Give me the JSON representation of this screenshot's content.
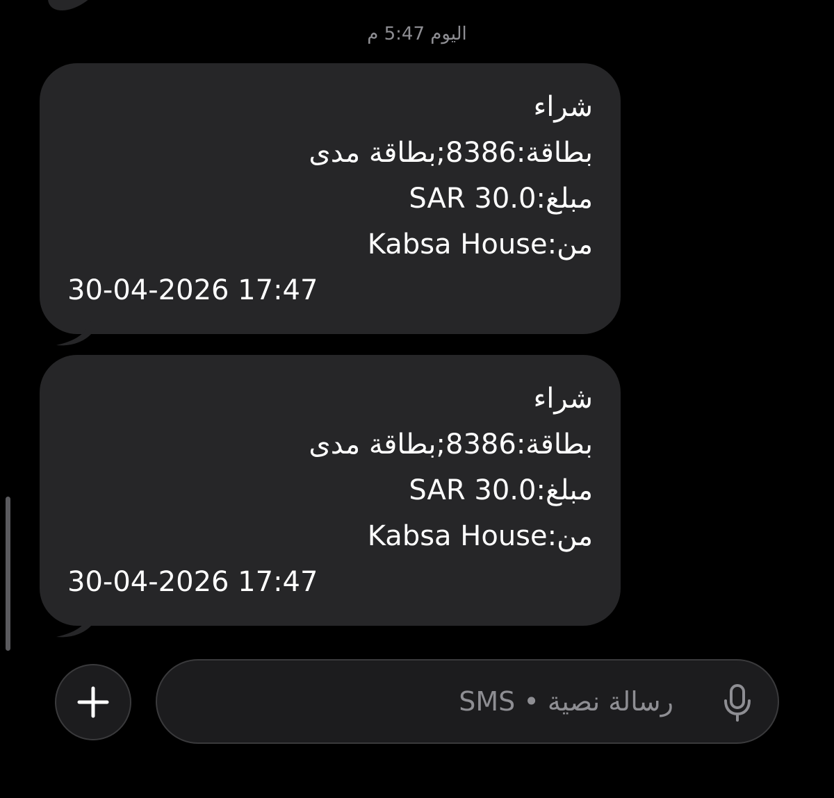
{
  "timestamp": "اليوم 5:47 م",
  "messages": [
    {
      "lines": [
        "شراء",
        "بطاقة:8386;بطاقة مدى",
        "مبلغ:SAR 30.0",
        "من:Kabsa House"
      ],
      "datetime": "30-04-2026 17:47"
    },
    {
      "lines": [
        "شراء",
        "بطاقة:8386;بطاقة مدى",
        "مبلغ:SAR 30.0",
        "من:Kabsa House"
      ],
      "datetime": "30-04-2026 17:47"
    }
  ],
  "composer": {
    "placeholder": "رسالة نصية • SMS",
    "add_icon": "plus-icon",
    "mic_icon": "microphone-icon"
  },
  "colors": {
    "background": "#000000",
    "bubble": "#262628",
    "secondary_text": "#8e8e93"
  }
}
